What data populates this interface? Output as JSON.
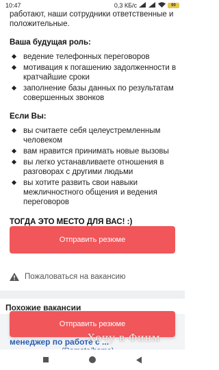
{
  "status_bar": {
    "time": "10:47",
    "speed": "0,3 КБ/с",
    "battery": "90"
  },
  "intro_text": "работают, наши сотрудники ответственные и положительные.",
  "role_section": {
    "title": "Ваша будущая роль:",
    "items": [
      "ведение телефонных переговоров",
      "мотивация к погашению задолженности в кратчайшие сроки",
      "заполнение базы данных по результатам совершенных звонков"
    ]
  },
  "if_section": {
    "title": "Если Вы:",
    "items": [
      "вы считаете себя целеустремленным человеком",
      "вам нравится принимать новые вызовы",
      "вы легко устанавливаете отношения в разговорах с другими людьми",
      "вы хотите развить свои навыки межличностного общения и ведения переговоров"
    ]
  },
  "cta_text": "ТОГДА ЭТО МЕСТО ДЛЯ ВАС! :)",
  "respond_button": "Отправить резюме",
  "complain_link": "Пожаловаться на вакансию",
  "similar": {
    "title": "Похожие вакансии",
    "job_title": "менеджер по работе с ...",
    "job_subtitle": "(Remote/home)"
  },
  "sticky_button": "Отправить резюме",
  "watermark": "Хочу в Финм",
  "colors": {
    "accent": "#f0565a",
    "link": "#2a5db0"
  },
  "icons": [
    "warning-icon",
    "wifi-icon",
    "signal-icon",
    "battery-icon",
    "nav-square-icon",
    "nav-circle-icon",
    "nav-back-icon"
  ]
}
